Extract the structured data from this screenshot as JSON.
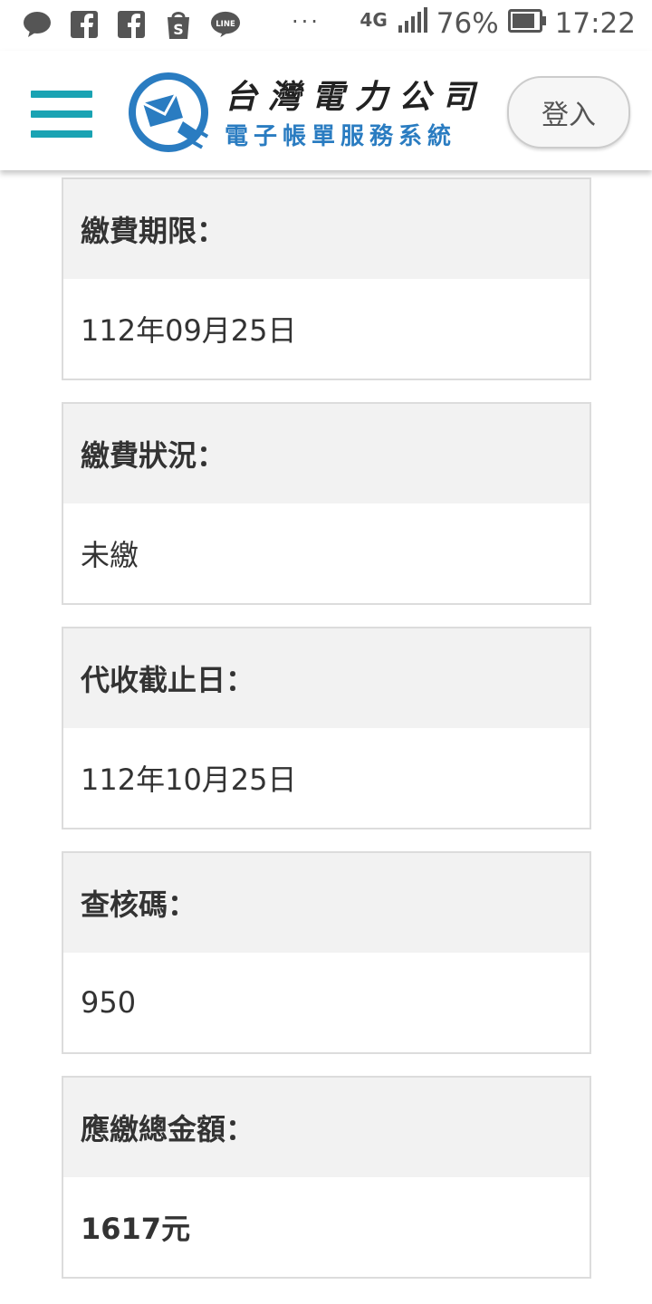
{
  "status_bar": {
    "icons": [
      "chat-bubble-icon",
      "facebook-icon",
      "facebook-icon",
      "shopping-bag-icon",
      "line-icon"
    ],
    "overflow": "···",
    "network": "4G",
    "battery_percent": "76%",
    "time": "17:22"
  },
  "header": {
    "logo_line1": "台灣電力公司",
    "logo_line2": "電子帳單服務系統",
    "login_label": "登入",
    "accent_color": "#1aa3b3",
    "logo_blue": "#2a7cc1"
  },
  "fields": [
    {
      "label": "繳費期限：",
      "value": "112年09月25日"
    },
    {
      "label": "繳費狀況：",
      "value": "未繳"
    },
    {
      "label": "代收截止日：",
      "value": "112年10月25日"
    },
    {
      "label": "查核碼：",
      "value": "950"
    },
    {
      "label": "應繳總金額：",
      "value": "1617元"
    }
  ]
}
